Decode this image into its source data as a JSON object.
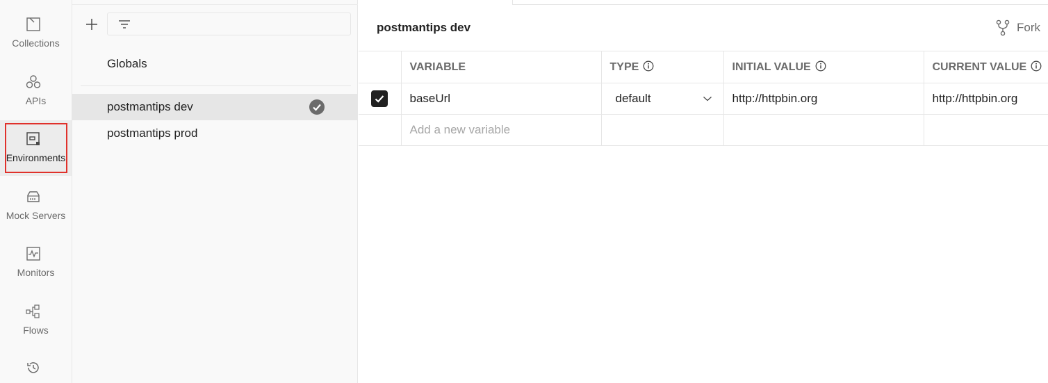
{
  "rail": {
    "items": [
      {
        "label": "Collections",
        "icon": "collections-icon"
      },
      {
        "label": "APIs",
        "icon": "apis-icon"
      },
      {
        "label": "Environments",
        "icon": "environments-icon"
      },
      {
        "label": "Mock Servers",
        "icon": "mock-servers-icon"
      },
      {
        "label": "Monitors",
        "icon": "monitors-icon"
      },
      {
        "label": "Flows",
        "icon": "flows-icon"
      },
      {
        "label": "",
        "icon": "history-icon"
      }
    ],
    "active_index": 2
  },
  "sidebar": {
    "globals_label": "Globals",
    "environments": [
      {
        "name": "postmantips dev",
        "active": true
      },
      {
        "name": "postmantips prod",
        "active": false
      }
    ]
  },
  "main": {
    "title": "postmantips dev",
    "fork_label": "Fork",
    "table": {
      "headers": {
        "variable": "VARIABLE",
        "type": "TYPE",
        "initial": "INITIAL VALUE",
        "current": "CURRENT VALUE"
      },
      "rows": [
        {
          "enabled": true,
          "variable": "baseUrl",
          "type": "default",
          "initial": "http://httpbin.org",
          "current": "http://httpbin.org"
        }
      ],
      "new_placeholder": "Add a new variable"
    }
  },
  "colors": {
    "highlight": "#e0312b",
    "selected_bg": "#e6e6e6"
  }
}
